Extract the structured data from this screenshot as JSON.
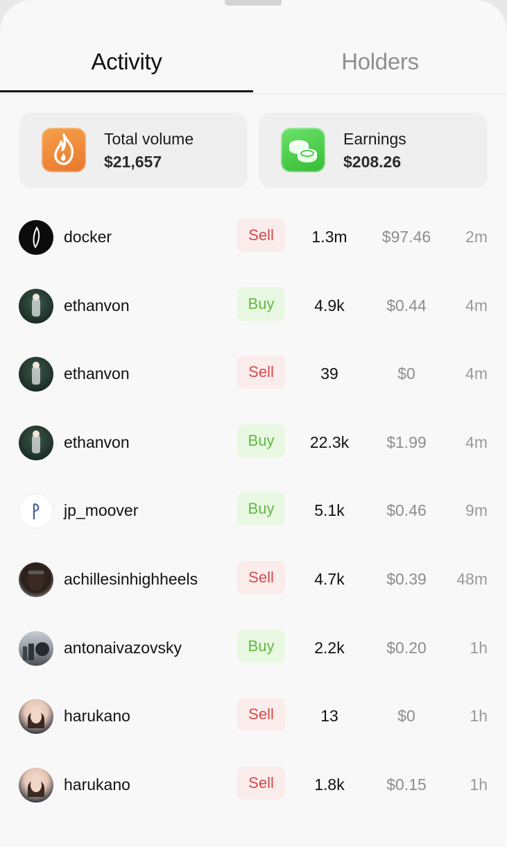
{
  "tabs": [
    {
      "label": "Activity",
      "active": true
    },
    {
      "label": "Holders",
      "active": false
    }
  ],
  "stats": {
    "volume": {
      "label": "Total volume",
      "value": "$21,657",
      "icon": "fire-icon",
      "color": "#ee8a36"
    },
    "earnings": {
      "label": "Earnings",
      "value": "$208.26",
      "icon": "coins-icon",
      "color": "#4ccf4c"
    }
  },
  "rows": [
    {
      "user": "docker",
      "type": "Sell",
      "amount": "1.3m",
      "price": "$97.46",
      "time": "2m",
      "avatar": "dark"
    },
    {
      "user": "ethanvon",
      "type": "Buy",
      "amount": "4.9k",
      "price": "$0.44",
      "time": "4m",
      "avatar": "forest"
    },
    {
      "user": "ethanvon",
      "type": "Sell",
      "amount": "39",
      "price": "$0",
      "time": "4m",
      "avatar": "forest"
    },
    {
      "user": "ethanvon",
      "type": "Buy",
      "amount": "22.3k",
      "price": "$1.99",
      "time": "4m",
      "avatar": "forest"
    },
    {
      "user": "jp_moover",
      "type": "Buy",
      "amount": "5.1k",
      "price": "$0.46",
      "time": "9m",
      "avatar": "white"
    },
    {
      "user": "achillesinhighheels",
      "type": "Sell",
      "amount": "4.7k",
      "price": "$0.39",
      "time": "48m",
      "avatar": "person"
    },
    {
      "user": "antonaivazovsky",
      "type": "Buy",
      "amount": "2.2k",
      "price": "$0.20",
      "time": "1h",
      "avatar": "city"
    },
    {
      "user": "harukano",
      "type": "Sell",
      "amount": "13",
      "price": "$0",
      "time": "1h",
      "avatar": "girl"
    },
    {
      "user": "harukano",
      "type": "Sell",
      "amount": "1.8k",
      "price": "$0.15",
      "time": "1h",
      "avatar": "girl"
    }
  ],
  "colors": {
    "sell_text": "#d34a4a",
    "sell_bg": "#fbecec",
    "buy_text": "#5fba40",
    "buy_bg": "#e9f8e2"
  }
}
